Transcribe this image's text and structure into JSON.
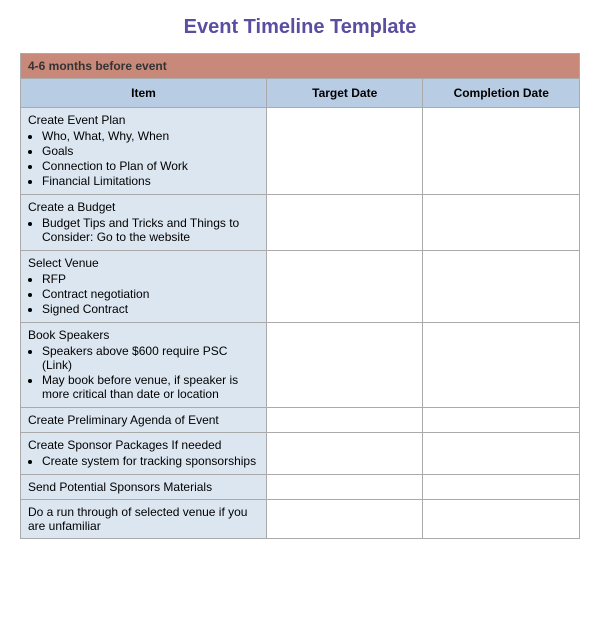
{
  "title": "Event Timeline Template",
  "sections": [
    {
      "section_label": "4-6 months before event",
      "headers": [
        "Item",
        "Target Date",
        "Completion Date"
      ],
      "rows": [
        {
          "item_title": "Create Event Plan",
          "item_bullets": [
            "Who, What, Why, When",
            "Goals",
            "Connection to Plan of Work",
            "Financial Limitations"
          ],
          "target_date": "",
          "completion_date": ""
        },
        {
          "item_title": "Create a Budget",
          "item_bullets": [
            "Budget Tips and Tricks and Things to Consider: Go to the website"
          ],
          "target_date": "",
          "completion_date": ""
        },
        {
          "item_title": "Select Venue",
          "item_bullets": [
            "RFP",
            "Contract negotiation",
            "Signed Contract"
          ],
          "target_date": "",
          "completion_date": ""
        },
        {
          "item_title": "Book Speakers",
          "item_bullets": [
            "Speakers above $600 require PSC (Link)",
            "May book before venue, if speaker is more critical than date or location"
          ],
          "target_date": "",
          "completion_date": ""
        },
        {
          "item_title": "Create Preliminary Agenda of Event",
          "item_bullets": [],
          "target_date": "",
          "completion_date": ""
        },
        {
          "item_title": "Create Sponsor Packages If needed",
          "item_bullets": [
            "Create system for tracking sponsorships"
          ],
          "target_date": "",
          "completion_date": ""
        },
        {
          "item_title": "Send Potential Sponsors Materials",
          "item_bullets": [],
          "target_date": "",
          "completion_date": ""
        },
        {
          "item_title": "Do a run through of selected venue if you are unfamiliar",
          "item_bullets": [],
          "target_date": "",
          "completion_date": ""
        }
      ]
    }
  ]
}
